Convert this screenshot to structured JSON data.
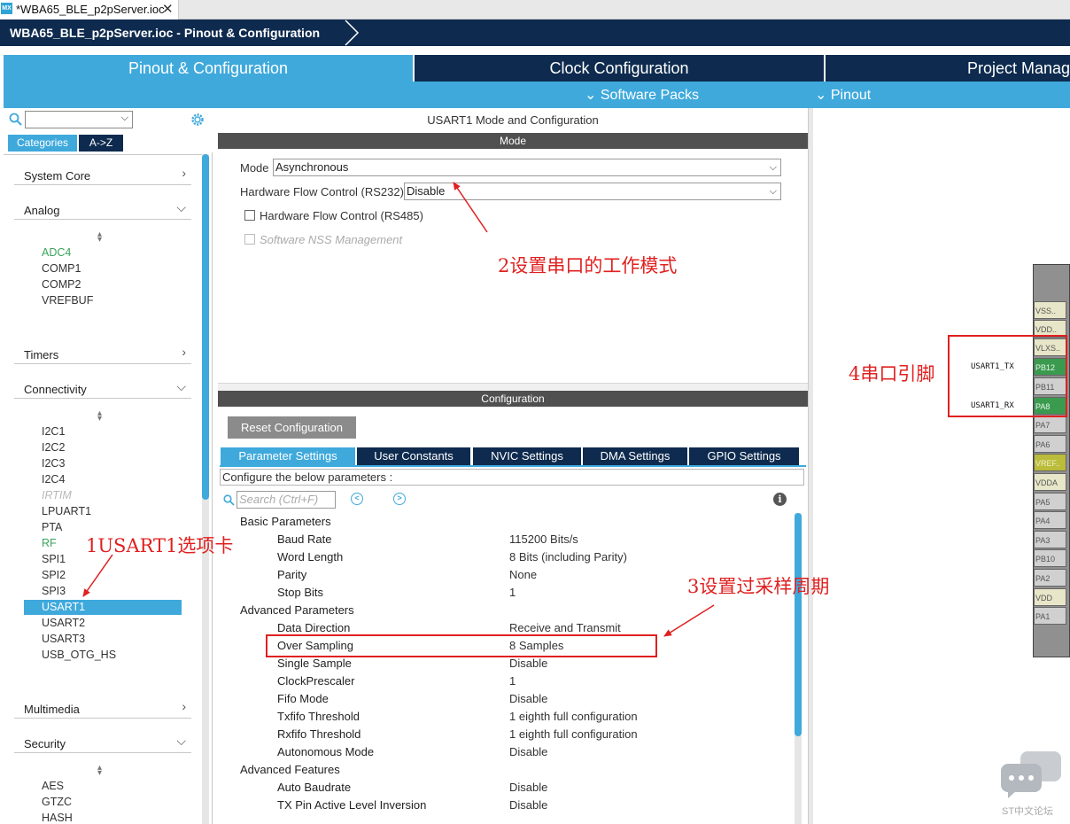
{
  "window": {
    "file_tab": "*WBA65_BLE_p2pServer.ioc",
    "logo": "MX",
    "breadcrumb": "WBA65_BLE_p2pServer.ioc - Pinout & Configuration"
  },
  "main_tabs": [
    "Pinout & Configuration",
    "Clock Configuration",
    "Project Manag"
  ],
  "subnav": {
    "software_packs": "Software Packs",
    "pinout": "Pinout"
  },
  "left": {
    "categories_label": "Categories",
    "az_label": "A->Z",
    "sections": {
      "system_core": "System Core",
      "analog": "Analog",
      "timers": "Timers",
      "connectivity": "Connectivity",
      "multimedia": "Multimedia",
      "security": "Security"
    },
    "analog_items": [
      "ADC4",
      "COMP1",
      "COMP2",
      "VREFBUF"
    ],
    "connectivity_items": [
      "I2C1",
      "I2C2",
      "I2C3",
      "I2C4",
      "IRTIM",
      "LPUART1",
      "PTA",
      "RF",
      "SPI1",
      "SPI2",
      "SPI3",
      "USART1",
      "USART2",
      "USART3",
      "USB_OTG_HS"
    ],
    "security_items": [
      "AES",
      "GTZC",
      "HASH"
    ]
  },
  "center": {
    "title": "USART1 Mode and Configuration",
    "mode_bar": "Mode",
    "mode_label": "Mode",
    "mode_value": "Asynchronous",
    "hwflow_label": "Hardware Flow Control (RS232)",
    "hwflow_value": "Disable",
    "rs485_label": "Hardware Flow Control (RS485)",
    "nss_label": "Software NSS Management",
    "config_bar": "Configuration",
    "reset_button": "Reset Configuration",
    "tabs": [
      "Parameter Settings",
      "User Constants",
      "NVIC Settings",
      "DMA Settings",
      "GPIO Settings"
    ],
    "configure_note": "Configure the below parameters :",
    "search_placeholder": "Search (Ctrl+F)",
    "groups": {
      "basic": "Basic Parameters",
      "advanced": "Advanced Parameters",
      "features": "Advanced Features"
    },
    "params": [
      {
        "name": "Baud Rate",
        "value": "115200 Bits/s"
      },
      {
        "name": "Word Length",
        "value": "8 Bits (including Parity)"
      },
      {
        "name": "Parity",
        "value": "None"
      },
      {
        "name": "Stop Bits",
        "value": "1"
      },
      {
        "name": "Data Direction",
        "value": "Receive and Transmit"
      },
      {
        "name": "Over Sampling",
        "value": "8 Samples"
      },
      {
        "name": "Single Sample",
        "value": "Disable"
      },
      {
        "name": "ClockPrescaler",
        "value": "1"
      },
      {
        "name": "Fifo Mode",
        "value": "Disable"
      },
      {
        "name": "Txfifo Threshold",
        "value": "1 eighth full configuration"
      },
      {
        "name": "Rxfifo Threshold",
        "value": "1 eighth full configuration"
      },
      {
        "name": "Autonomous Mode",
        "value": "Disable"
      },
      {
        "name": "Auto Baudrate",
        "value": "Disable"
      },
      {
        "name": "TX Pin Active Level Inversion",
        "value": "Disable"
      }
    ]
  },
  "pinout": {
    "pins": [
      "VSS..",
      "VDD..",
      "VLXS..",
      "PB12",
      "PB11",
      "PA8",
      "PA7",
      "PA6",
      "VREF..",
      "VDDA",
      "PA5",
      "PA4",
      "PA3",
      "PB10",
      "PA2",
      "VDD",
      "PA1"
    ],
    "signal_tx": "USART1_TX",
    "signal_rx": "USART1_RX"
  },
  "annotations": {
    "a1": "1USART1选项卡",
    "a2": "2设置串口的工作模式",
    "a3": "3设置过采样周期",
    "a4": "4串口引脚",
    "color": "#e02020"
  },
  "watermark": "ST中文论坛",
  "colors": {
    "accent": "#3fa9dc",
    "navy": "#0e2b4f",
    "green": "#3a9b4f"
  }
}
